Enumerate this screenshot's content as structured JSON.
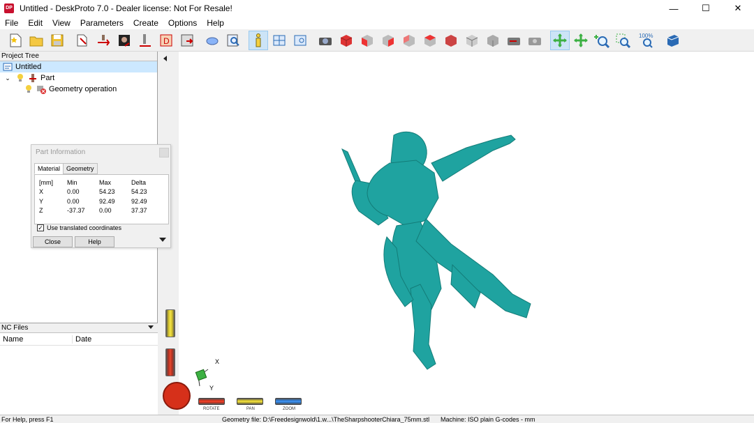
{
  "window": {
    "title": "Untitled - DeskProto 7.0 - Dealer license: Not For Resale!",
    "app_icon": "DP",
    "controls": [
      "—",
      "☐",
      "✕"
    ]
  },
  "menu": [
    "File",
    "Edit",
    "View",
    "Parameters",
    "Create",
    "Options",
    "Help"
  ],
  "toolbar": {
    "zoom_badge": "100%",
    "icons": [
      "new-file-icon",
      "open-folder-icon",
      "save-icon",
      "wizard-icon",
      "part-wizard-icon",
      "image-wizard-icon",
      "cam-wizard-icon",
      "drawing-icon",
      "save-nc-icon",
      "select-icon",
      "inspect-icon",
      "info-icon",
      "layout-icon",
      "layout2-icon",
      "camera-icon",
      "view-cube-icon",
      "view-front-icon",
      "view-right-icon",
      "view-back-icon",
      "view-left-icon",
      "view-top-icon",
      "view-iso-icon",
      "view-bottom-icon",
      "camera-reset-icon",
      "camera-pan-icon",
      "rotate-mode-icon",
      "pan-mode-icon",
      "zoom-mode-icon",
      "zoom-window-icon",
      "zoom-100-icon",
      "book-icon"
    ]
  },
  "project_tree": {
    "header": "Project Tree",
    "items": [
      {
        "label": "Untitled"
      },
      {
        "label": "Part"
      },
      {
        "label": "Geometry operation"
      }
    ]
  },
  "nc_files": {
    "header": "NC Files",
    "columns": [
      "Name",
      "Date"
    ]
  },
  "part_info": {
    "title": "Part Information",
    "tabs": [
      "Material",
      "Geometry"
    ],
    "header": [
      "[mm]",
      "Min",
      "Max",
      "Delta"
    ],
    "rows": [
      [
        "X",
        "0.00",
        "54.23",
        "54.23"
      ],
      [
        "Y",
        "0.00",
        "92.49",
        "92.49"
      ],
      [
        "Z",
        "-37.37",
        "0.00",
        "37.37"
      ]
    ],
    "checkbox_label": "Use translated coordinates",
    "checkbox_checked": true,
    "close_label": "Close",
    "help_label": "Help"
  },
  "viewport": {
    "model_color": "#1fa3a0",
    "axis_x": "X",
    "axis_y": "Y",
    "dials": {
      "rotate_label": "ROTATE",
      "pan_label": "PAN",
      "zoom_label": "ZOOM"
    }
  },
  "status": {
    "help": "For Help, press F1",
    "geometry": "Geometry file: D:\\Freedesignwold\\1.w...\\TheSharpshooterChiara_75mm.stl",
    "machine": "Machine: ISO plain G-codes - mm"
  }
}
